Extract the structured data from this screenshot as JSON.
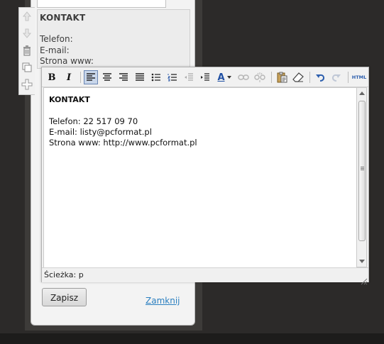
{
  "preview": {
    "title": "KONTAKT",
    "lines": [
      "Telefon:",
      "E-mail:",
      "Strona www:"
    ]
  },
  "side_tools": [
    "arrow-up-icon",
    "arrow-down-icon",
    "trash-icon",
    "duplicate-icon",
    "add-icon"
  ],
  "toolbar": {
    "bold_label": "B",
    "italic_label": "I",
    "html_label": "HTML",
    "font_color_label": "A",
    "font_color": "#1f4fa3"
  },
  "editor": {
    "title": "KONTAKT",
    "lines": [
      "Telefon: 22 517 09 70",
      "E-mail: listy@pcformat.pl",
      "Strona www: http://www.pcformat.pl"
    ]
  },
  "status": {
    "path_label": "Ścieżka: p"
  },
  "actions": {
    "save_label": "Zapisz",
    "close_label": "Zamknij"
  },
  "colors": {
    "background": "#2c2a29",
    "link": "#2a7fc0",
    "active_button": "#c8d6ea"
  }
}
